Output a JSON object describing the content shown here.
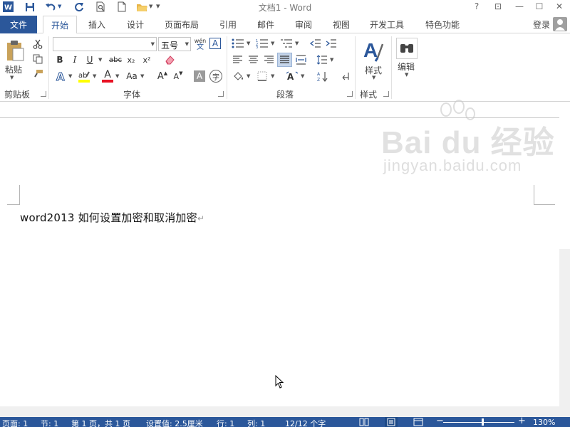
{
  "window": {
    "title": "文档1 - Word",
    "help_label": "?",
    "restore_ribbon_label": "⊡",
    "minimize_label": "—",
    "maximize_label": "☐",
    "close_label": "✕"
  },
  "quick_access": {
    "customize_label": "▾"
  },
  "tabs": {
    "file": "文件",
    "items": [
      "开始",
      "插入",
      "设计",
      "页面布局",
      "引用",
      "邮件",
      "审阅",
      "视图",
      "开发工具",
      "特色功能"
    ],
    "active": "开始",
    "login": "登录"
  },
  "ribbon": {
    "clipboard": {
      "paste_label": "粘贴",
      "group_label": "剪贴板"
    },
    "font": {
      "font_name": "",
      "font_size": "五号",
      "phonetic_label": "wén",
      "phonetic_sub": "文",
      "border_char_label": "A",
      "bold": "B",
      "italic": "I",
      "underline": "U",
      "strike": "abc",
      "subscript": "x₂",
      "superscript": "x²",
      "change_case": "Aa",
      "grow": "A",
      "shrink": "A",
      "char_shading": "A",
      "enclose": "字",
      "group_label": "字体"
    },
    "paragraph": {
      "group_label": "段落"
    },
    "styles": {
      "styles_label": "样式",
      "group_label": "样式"
    },
    "editing": {
      "editing_label": "编辑"
    },
    "colors": {
      "highlight": "#ffff00",
      "font_color": "#e81123",
      "accent": "#2b579a"
    }
  },
  "document": {
    "text": "word2013  如何设置加密和取消加密",
    "para_mark": "↵"
  },
  "watermark": {
    "main": "Bai du 经验",
    "sub": "jingyan.baidu.com"
  },
  "statusbar": {
    "page": "页面: 1",
    "section": "节: 1",
    "page_of": "第 1 页，共 1 页",
    "position": "设置值: 2.5厘米",
    "line": "行: 1",
    "column": "列: 1",
    "word_count": "12/12 个字",
    "zoom_out": "−",
    "zoom_in": "+",
    "zoom": "130%",
    "zoom_fraction": 0.55
  }
}
